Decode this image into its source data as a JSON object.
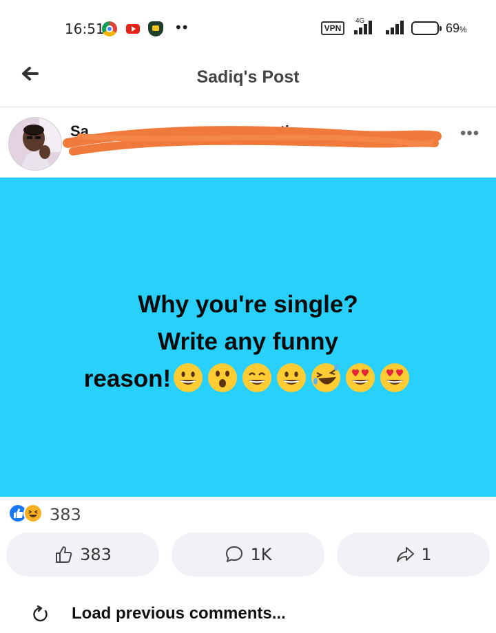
{
  "status_bar": {
    "time": "16:51",
    "vpn": "VPN",
    "network": "4G",
    "battery": "69",
    "battery_unit": "%",
    "battery_level": 0.69,
    "icons": [
      "chrome-icon",
      "youtube-icon",
      "shield-app-icon",
      "more-dots-icon",
      "signal-icon",
      "battery-icon"
    ]
  },
  "header": {
    "title": "Sadiq's Post",
    "back_icon": "arrow-left-icon"
  },
  "post": {
    "author_visible_fragment": "Sa",
    "action_visible_fragment": "question",
    "body_lines": [
      "Why you're single?",
      "Write any funny",
      "reason!"
    ],
    "emojis": [
      "grinning",
      "astonished",
      "grinning-squint",
      "grinning",
      "rolling-laughing",
      "heart-eyes",
      "heart-eyes"
    ],
    "background_color": "#29d0fa"
  },
  "reactions": {
    "icons": [
      "like-reaction-icon",
      "haha-reaction-icon"
    ],
    "count": "383"
  },
  "actions": {
    "like_count": "383",
    "comment_count": "1K",
    "share_count": "1"
  },
  "comments": {
    "load_previous": "Load previous comments..."
  }
}
